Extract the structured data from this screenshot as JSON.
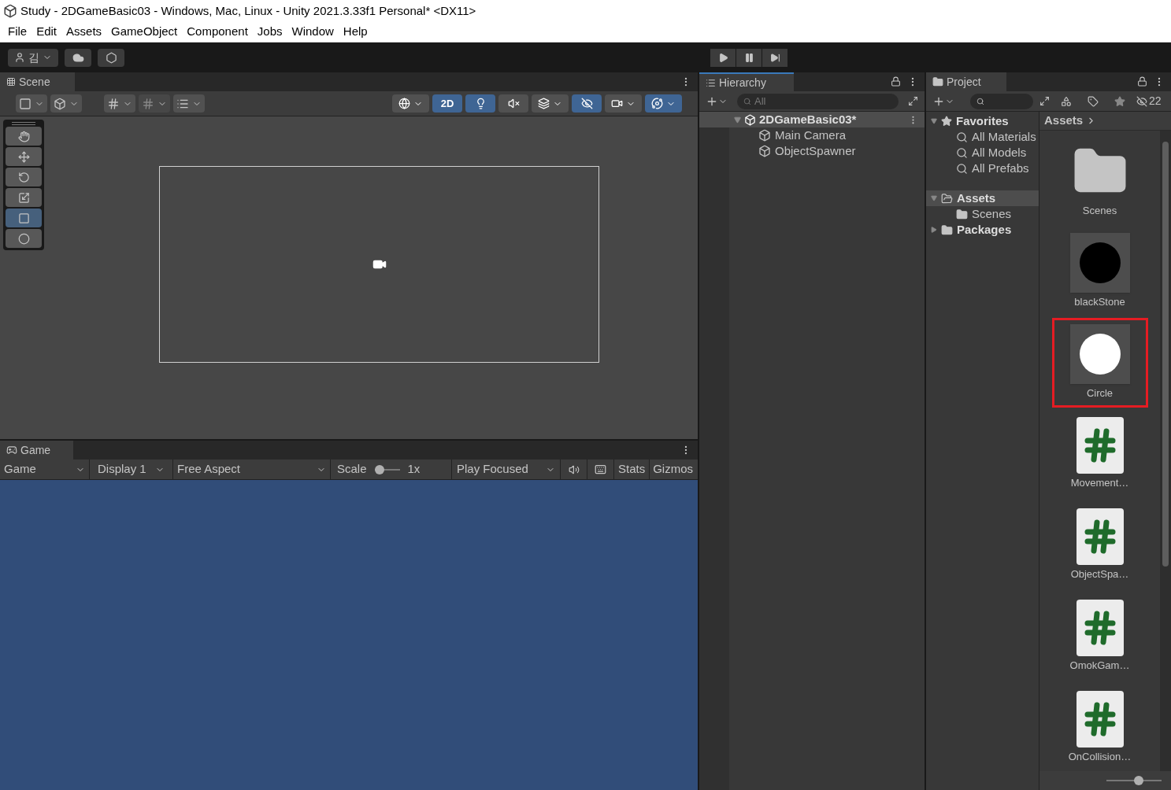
{
  "window": {
    "title": "Study - 2DGameBasic03 - Windows, Mac, Linux - Unity 2021.3.33f1 Personal* <DX11>"
  },
  "menu": [
    "File",
    "Edit",
    "Assets",
    "GameObject",
    "Component",
    "Jobs",
    "Window",
    "Help"
  ],
  "toolbar": {
    "account": "김"
  },
  "scene": {
    "tab": "Scene",
    "toggles": [
      {
        "kind": "shading",
        "on": false
      },
      {
        "kind": "dimension",
        "label": "2D",
        "on": true
      },
      {
        "kind": "light",
        "on": true
      },
      {
        "kind": "audio",
        "on": false
      },
      {
        "kind": "effects",
        "on": false
      },
      {
        "kind": "visibility",
        "on": true
      },
      {
        "kind": "camera",
        "on": false
      },
      {
        "kind": "gizmos",
        "on": true
      }
    ],
    "tools": [
      {
        "kind": "hand",
        "selected": false
      },
      {
        "kind": "move",
        "selected": false
      },
      {
        "kind": "rotate",
        "selected": false
      },
      {
        "kind": "scale",
        "selected": false
      },
      {
        "kind": "rect",
        "selected": true
      },
      {
        "kind": "transform",
        "selected": false
      }
    ]
  },
  "game": {
    "tab": "Game",
    "mode": "Game",
    "display": "Display 1",
    "aspect": "Free Aspect",
    "scale_label": "Scale",
    "scale_value": "1x",
    "play_mode": "Play Focused",
    "stats": "Stats",
    "gizmos": "Gizmos"
  },
  "hierarchy": {
    "title": "Hierarchy",
    "search": {
      "placeholder": "All"
    },
    "scene": {
      "name": "2DGameBasic03*",
      "expanded": true,
      "children": [
        "Main Camera",
        "ObjectSpawner"
      ]
    }
  },
  "project": {
    "title": "Project",
    "hidden_count": "22",
    "tree": [
      {
        "name": "Favorites",
        "kind": "favorites",
        "expanded": true,
        "children": [
          "All Materials",
          "All Models",
          "All Prefabs"
        ]
      },
      {
        "name": "Assets",
        "kind": "folder",
        "expanded": true,
        "selected": true,
        "children": [
          "Scenes"
        ]
      },
      {
        "name": "Packages",
        "kind": "folder",
        "expanded": false,
        "selected": false
      }
    ],
    "breadcrumb": "Assets",
    "items": [
      {
        "name": "Scenes",
        "kind": "folder",
        "selected": false
      },
      {
        "name": "blackStone",
        "kind": "sprite",
        "color": "#000000",
        "selected": false
      },
      {
        "name": "Circle",
        "kind": "sprite",
        "color": "#ffffff",
        "selected": true
      },
      {
        "name": "Movement…",
        "kind": "script",
        "selected": false
      },
      {
        "name": "ObjectSpa…",
        "kind": "script",
        "selected": false
      },
      {
        "name": "OmokGam…",
        "kind": "script",
        "selected": false
      },
      {
        "name": "OnCollision…",
        "kind": "script",
        "selected": false
      }
    ],
    "zoom": {
      "level": 0.6
    }
  }
}
